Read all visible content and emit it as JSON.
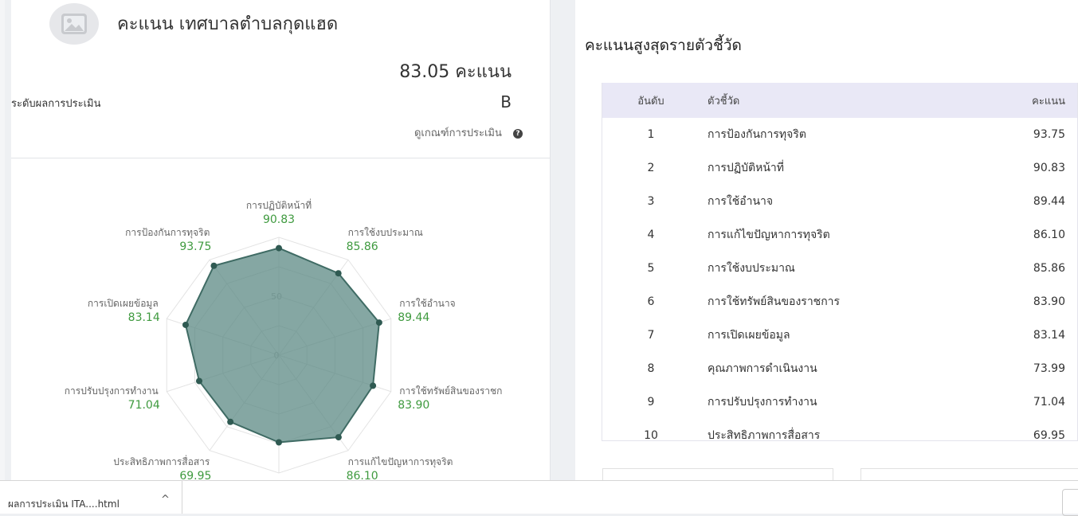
{
  "summary": {
    "title": "คะแนน เทศบาลตำบลกุดแฮด",
    "score_text": "83.05 คะแนน",
    "level_label": "ระดับผลการประเมิน",
    "grade": "B",
    "criteria_link": "ดูเกณฑ์การประเมิน"
  },
  "chart_data": {
    "type": "radar",
    "axis_max": 100,
    "ticks": [
      "0",
      "50"
    ],
    "axes": [
      {
        "label": "การปฏิบัติหน้าที่",
        "value": 90.83
      },
      {
        "label": "การใช้งบประมาณ",
        "value": 85.86
      },
      {
        "label": "การใช้อำนาจ",
        "value": 89.44
      },
      {
        "label": "การใช้ทรัพย์สินของราชก",
        "value": 83.9
      },
      {
        "label": "การแก้ไขปัญหาการทุจริต",
        "value": 86.1
      },
      {
        "label": "",
        "value": 73.99
      },
      {
        "label": "ประสิทธิภาพการสื่อสาร",
        "value": 69.95
      },
      {
        "label": "การปรับปรุงการทำงาน",
        "value": 71.04
      },
      {
        "label": "การเปิดเผยข้อมูล",
        "value": 83.14
      },
      {
        "label": "การป้องกันการทุจริต",
        "value": 93.75
      }
    ],
    "value_labels": [
      "90.83",
      "85.86",
      "89.44",
      "83.90",
      "86.10",
      "",
      "69.95",
      "71.04",
      "83.14",
      "93.75"
    ],
    "colors": {
      "fill": "#5c8a84",
      "stroke": "#3f6b64",
      "point": "#2f5a52",
      "value_text": "#3f9a3f",
      "grid": "#e3e3e3"
    }
  },
  "ranking": {
    "title": "คะแนนสูงสุดรายตัวชี้วัด",
    "columns": [
      "อันดับ",
      "ตัวชี้วัด",
      "คะแนน"
    ],
    "rows": [
      [
        "1",
        "การป้องกันการทุจริต",
        "93.75"
      ],
      [
        "2",
        "การปฏิบัติหน้าที่",
        "90.83"
      ],
      [
        "3",
        "การใช้อำนาจ",
        "89.44"
      ],
      [
        "4",
        "การแก้ไขปัญหาการทุจริต",
        "86.10"
      ],
      [
        "5",
        "การใช้งบประมาณ",
        "85.86"
      ],
      [
        "6",
        "การใช้ทรัพย์สินของราชการ",
        "83.90"
      ],
      [
        "7",
        "การเปิดเผยข้อมูล",
        "83.14"
      ],
      [
        "8",
        "คุณภาพการดำเนินงาน",
        "73.99"
      ],
      [
        "9",
        "การปรับปรุงการทำงาน",
        "71.04"
      ],
      [
        "10",
        "ประสิทธิภาพการสื่อสาร",
        "69.95"
      ]
    ]
  },
  "download": {
    "filename": "ผลการประเมิน ITA....html",
    "chevron": "^"
  },
  "icons": [
    "image-placeholder-icon",
    "help-icon",
    "chevron-up-icon"
  ]
}
